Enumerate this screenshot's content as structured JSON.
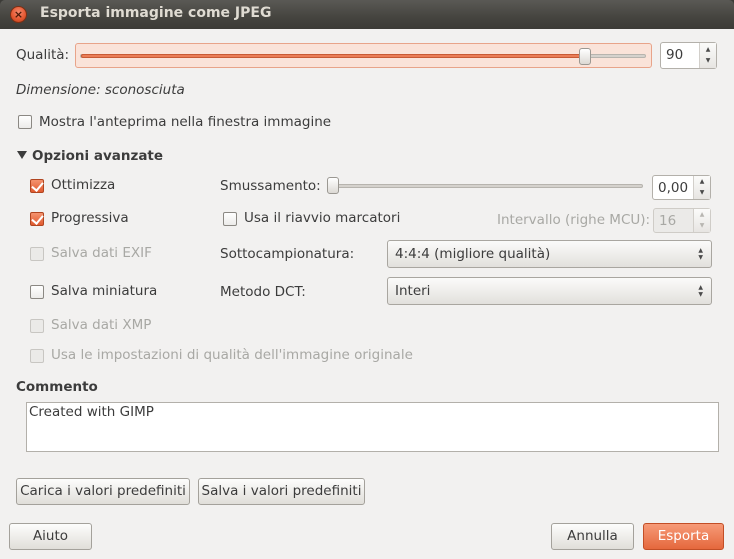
{
  "window": {
    "title": "Esporta immagine come JPEG"
  },
  "quality": {
    "label": "Qualità:",
    "value": "90",
    "level": 90
  },
  "size_label": "Dimensione: sconosciuta",
  "preview": {
    "label": "Mostra l'anteprima nella finestra immagine",
    "checked": false
  },
  "advanced": {
    "label": "Opzioni avanzate"
  },
  "options": {
    "optimize": {
      "label": "Ottimizza",
      "checked": true
    },
    "progressive": {
      "label": "Progressiva",
      "checked": true
    },
    "exif": {
      "label": "Salva dati EXIF",
      "checked": false,
      "disabled": true
    },
    "thumbnail": {
      "label": "Salva miniatura",
      "checked": false
    },
    "xmp": {
      "label": "Salva dati XMP",
      "checked": false,
      "disabled": true
    },
    "orig_quality": {
      "label": "Usa le impostazioni di qualità dell'immagine originale",
      "checked": false,
      "disabled": true
    },
    "restart": {
      "label": "Usa il riavvio marcatori",
      "checked": false
    }
  },
  "smoothing": {
    "label": "Smussamento:",
    "value": "0,00",
    "level": 0
  },
  "interval": {
    "label": "Intervallo (righe MCU):",
    "value": "16"
  },
  "subsampling": {
    "label": "Sottocampionatura:",
    "value": "4:4:4 (migliore qualità)"
  },
  "dct": {
    "label": "Metodo DCT:",
    "value": "Interi"
  },
  "comment": {
    "label": "Commento",
    "value": "Created with GIMP"
  },
  "buttons": {
    "load_defaults": "Carica i valori predefiniti",
    "save_defaults": "Salva i valori predefiniti",
    "help": "Aiuto",
    "cancel": "Annulla",
    "export": "Esporta"
  },
  "colors": {
    "accent": "#e5683d",
    "titlebar": "#3c3b37",
    "dialog_bg": "#f2f1f0"
  }
}
